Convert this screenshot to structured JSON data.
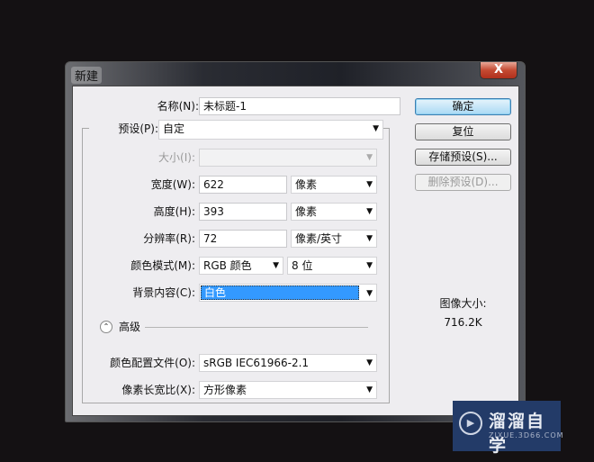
{
  "window": {
    "title": "新建",
    "close": "X"
  },
  "form": {
    "name_label": "名称(N):",
    "name_value": "未标题-1",
    "preset_label": "预设(P):",
    "preset_value": "自定",
    "size_label": "大小(I):",
    "size_value": "",
    "width_label": "宽度(W):",
    "width_value": "622",
    "width_unit": "像素",
    "height_label": "高度(H):",
    "height_value": "393",
    "height_unit": "像素",
    "resolution_label": "分辨率(R):",
    "resolution_value": "72",
    "resolution_unit": "像素/英寸",
    "color_mode_label": "颜色模式(M):",
    "color_mode_value": "RGB 颜色",
    "bit_depth": "8 位",
    "background_label": "背景内容(C):",
    "background_value": "白色",
    "advanced_label": "高级",
    "profile_label": "颜色配置文件(O):",
    "profile_value": "sRGB IEC61966-2.1",
    "aspect_label": "像素长宽比(X):",
    "aspect_value": "方形像素"
  },
  "buttons": {
    "ok": "确定",
    "reset": "复位",
    "save_preset": "存储预设(S)...",
    "delete_preset": "删除预设(D)..."
  },
  "image_size": {
    "label": "图像大小:",
    "value": "716.2K"
  },
  "watermark": {
    "name": "溜溜自学",
    "url": "ZIXUE.3D66.COM"
  }
}
